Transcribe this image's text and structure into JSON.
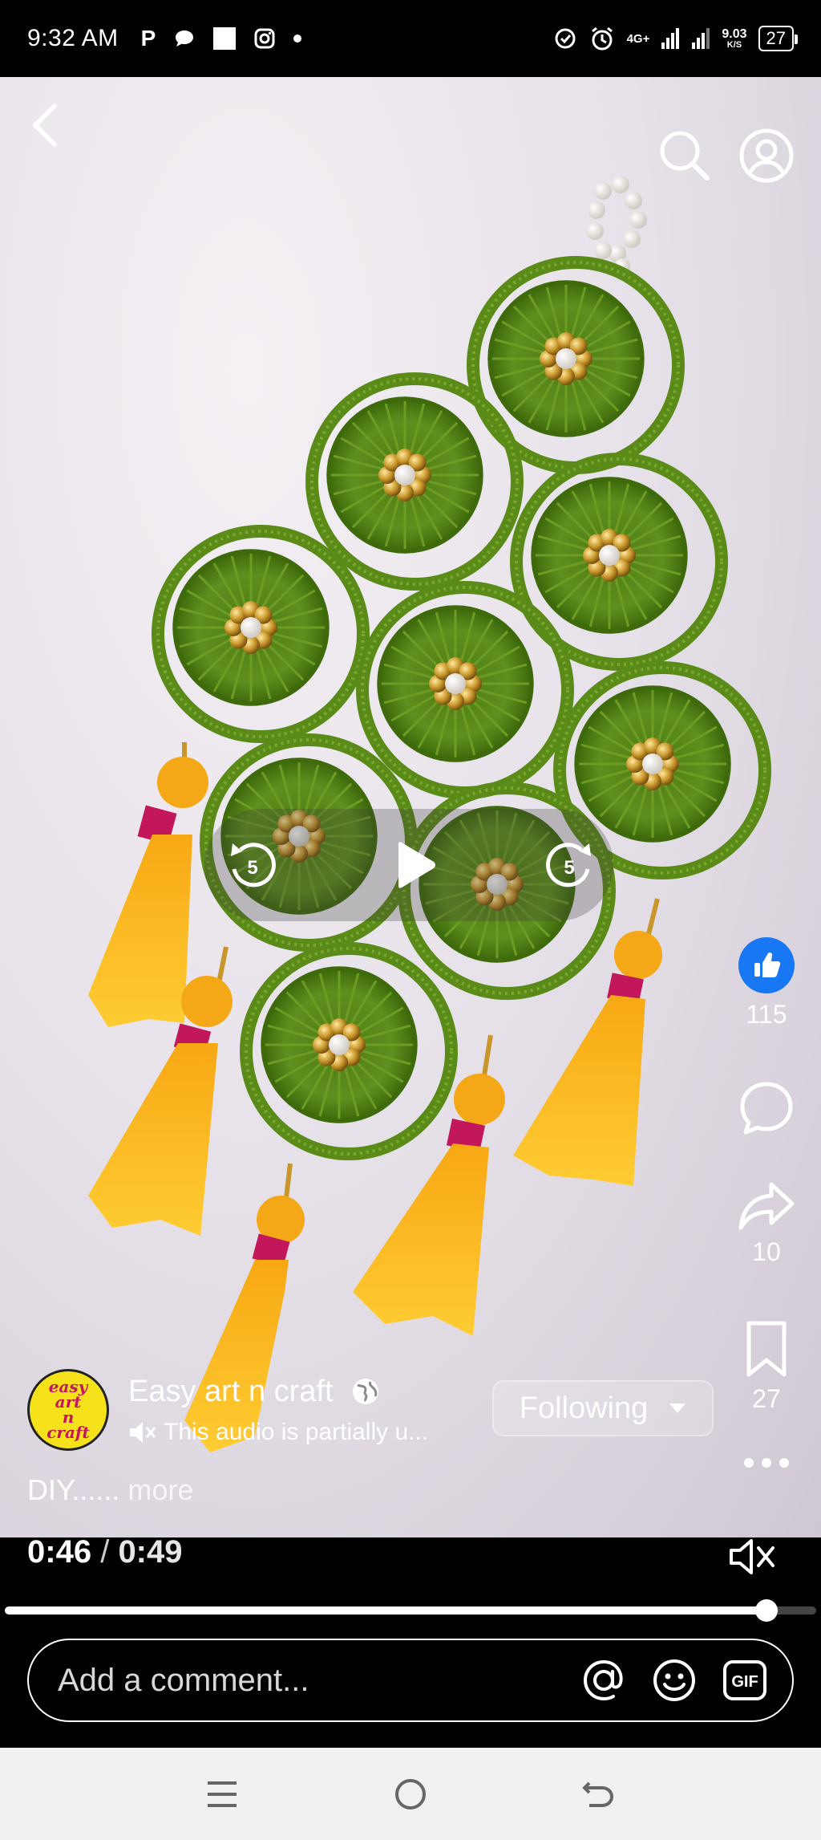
{
  "status_bar": {
    "time": "9:32 AM",
    "app_letter": "P",
    "network": "4G+",
    "speed_value": "9.03",
    "speed_unit": "K/S",
    "battery": "27"
  },
  "video": {
    "rewind_seconds": "5",
    "forward_seconds": "5"
  },
  "rail": {
    "like_count": "115",
    "share_count": "10",
    "save_count": "27"
  },
  "channel": {
    "name": "Easy art n craft",
    "audio_text": "This audio is partially u...",
    "follow_label": "Following",
    "avatar_lines": [
      "easy",
      "art",
      "n",
      "craft"
    ]
  },
  "caption": {
    "text": "DIY......",
    "more": "more"
  },
  "player": {
    "current_time": "0:46",
    "separator": "/",
    "duration": "0:49",
    "progress_fraction": 0.939
  },
  "comment": {
    "placeholder": "Add a comment..."
  },
  "colors": {
    "like_blue": "#1877f2",
    "yarn_green": "#5f8f1e",
    "tassel_yellow": "#f7b21a",
    "bead_gold": "#c8962a"
  }
}
